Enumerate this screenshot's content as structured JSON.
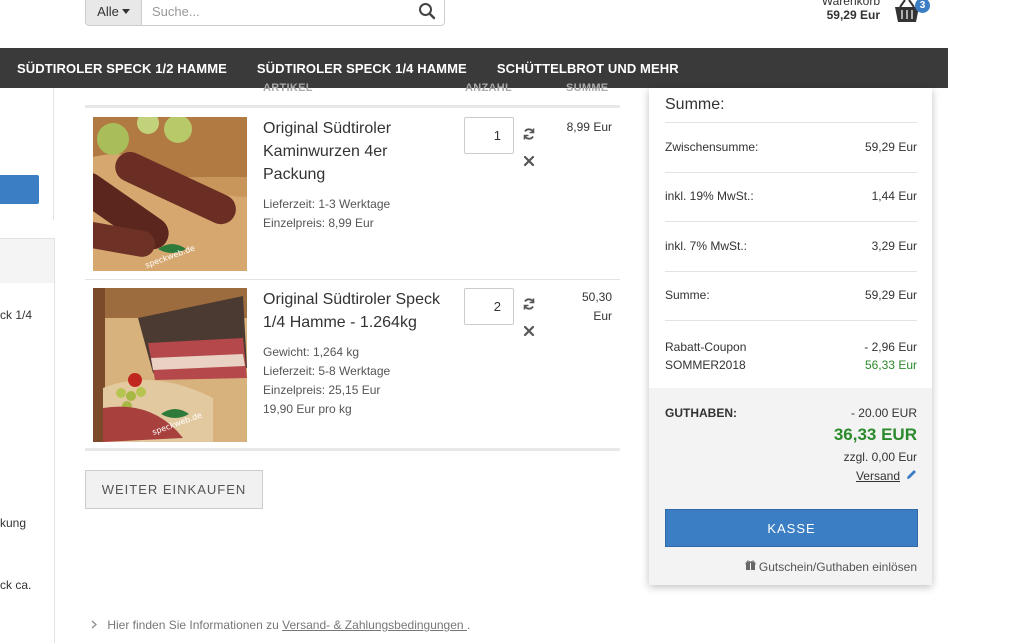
{
  "search": {
    "category": "Alle",
    "placeholder": "Suche..."
  },
  "cart_header": {
    "label": "Warenkorb",
    "total": "59,29 Eur",
    "count": "3"
  },
  "nav": {
    "items": [
      "SÜDTIROLER SPECK 1/2 HAMME",
      "SÜDTIROLER SPECK 1/4 HAMME",
      "SCHÜTTELBROT UND MEHR"
    ]
  },
  "sidebar_fragments": [
    "ck 1/4",
    "kung",
    "ck ca."
  ],
  "table": {
    "headers": {
      "article": "ARTIKEL",
      "quantity": "ANZAHL",
      "total": "SUMME"
    },
    "items": [
      {
        "name": "Original Südtiroler Kaminwurzen 4er Packung",
        "meta": [
          "Lieferzeit: 1-3 Werktage",
          "Einzelpreis: 8,99 Eur"
        ],
        "quantity": "1",
        "price": "8,99 Eur"
      },
      {
        "name": "Original Südtiroler Speck 1/4 Hamme - 1.264kg",
        "meta": [
          "Gewicht: 1,264 kg",
          "Lieferzeit: 5-8 Werktage",
          "Einzelpreis: 25,15 Eur",
          "19,90 Eur pro kg"
        ],
        "quantity": "2",
        "price_line1": "50,30",
        "price_line2": "Eur"
      }
    ]
  },
  "continue_button": "WEITER EINKAUFEN",
  "footer": {
    "prefix": "Hier finden Sie Informationen zu ",
    "link": "Versand- & Zahlungsbedingungen ",
    "suffix": "."
  },
  "summary": {
    "title": "Summe:",
    "rows": [
      {
        "label": "Zwischensumme:",
        "value": "59,29 Eur"
      },
      {
        "label": "inkl. 19% MwSt.:",
        "value": "1,44 Eur"
      },
      {
        "label": "inkl. 7% MwSt.:",
        "value": "3,29 Eur"
      },
      {
        "label": "Summe:",
        "value": "59,29 Eur"
      }
    ],
    "coupon": {
      "label1": "Rabatt-Coupon",
      "label2": "SOMMER2018",
      "discount": "- 2,96 Eur",
      "new_total": "56,33 Eur"
    },
    "credit": {
      "label": "GUTHABEN:",
      "deduction": "- 20.00 EUR",
      "total": "36,33 EUR",
      "shipping": "zzgl. 0,00 Eur",
      "shipping_link": "Versand"
    },
    "checkout_button": "KASSE",
    "voucher_link": "Gutschein/Guthaben einlösen"
  },
  "colors": {
    "accent": "#3b7ec3",
    "nav_bg": "#3a3a3a",
    "green": "#2b8a2b"
  }
}
